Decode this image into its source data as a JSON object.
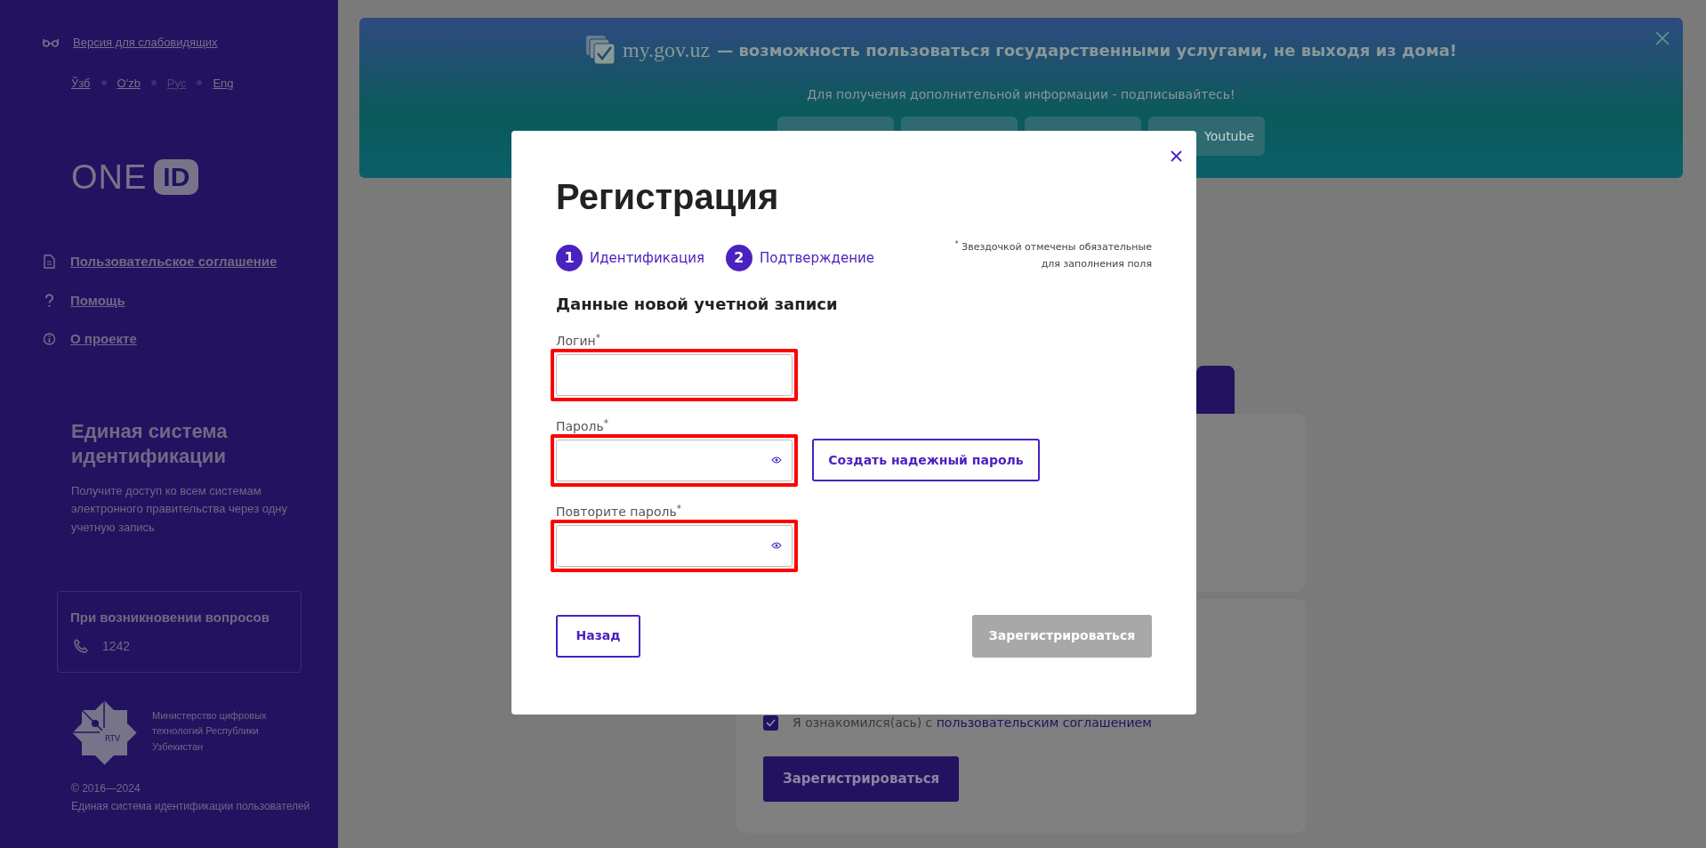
{
  "sidebar": {
    "accessibility_link": "Версия для слабовидящих",
    "languages": [
      {
        "label": "Ўзб",
        "selected": false
      },
      {
        "label": "O'zb",
        "selected": false
      },
      {
        "label": "Рус",
        "selected": true
      },
      {
        "label": "Eng",
        "selected": false
      }
    ],
    "logo": {
      "word": "ONE",
      "badge": "ID"
    },
    "menu": [
      {
        "kind": "document",
        "label": "Пользовательское соглашение"
      },
      {
        "kind": "help",
        "label": "Помощь"
      },
      {
        "kind": "info",
        "label": "О проекте"
      }
    ],
    "intro": {
      "title": "Единая система идентификации",
      "text": "Получите доступ ко всем системам электронного правительства через одну учетную запись"
    },
    "support": {
      "title": "При возникновении вопросов",
      "phone": "1242"
    },
    "ministry": {
      "logo_text": "RTV",
      "name": "Министерство цифровых технологий Республики Узбекистан"
    },
    "copyright": "© 2016—2024",
    "footer_text": "Единая система идентификации пользователей"
  },
  "banner": {
    "site": "my.gov.uz",
    "headline": "— возможность пользоваться государственными услугами, не выходя из дома!",
    "subtitle": "Для получения дополнительной информации - подписывайтесь!",
    "social_buttons": [
      {
        "kind": "blank"
      },
      {
        "kind": "blank"
      },
      {
        "kind": "blank"
      },
      {
        "kind": "labeled",
        "label": "Youtube"
      }
    ]
  },
  "background_form": {
    "agreement": {
      "checked": true,
      "text": "Я ознакомился(ась) с",
      "link": "пользовательским соглашением"
    },
    "submit_button": "Зарегистрироваться"
  },
  "modal": {
    "title": "Регистрация",
    "steps": [
      {
        "number": "1",
        "label": "Идентификация"
      },
      {
        "number": "2",
        "label": "Подтверждение"
      }
    ],
    "required_note": "$^{*}$ Звездочкой отмечены обязательные для заполнения поля",
    "section_title": "Данные новой учетной записи",
    "fields": [
      {
        "kind": "text",
        "label": "Логин$^{*}$",
        "highlighted": true
      },
      {
        "kind": "password",
        "label": "Пароль$^{*}$",
        "highlighted": true,
        "action": "Создать надежный пароль"
      },
      {
        "kind": "password",
        "label": "Повторите пароль$^{*}$",
        "highlighted": true
      }
    ],
    "back_button": "Назад",
    "submit_button": {
      "label": "Зарегистрироваться",
      "disabled": true
    }
  }
}
